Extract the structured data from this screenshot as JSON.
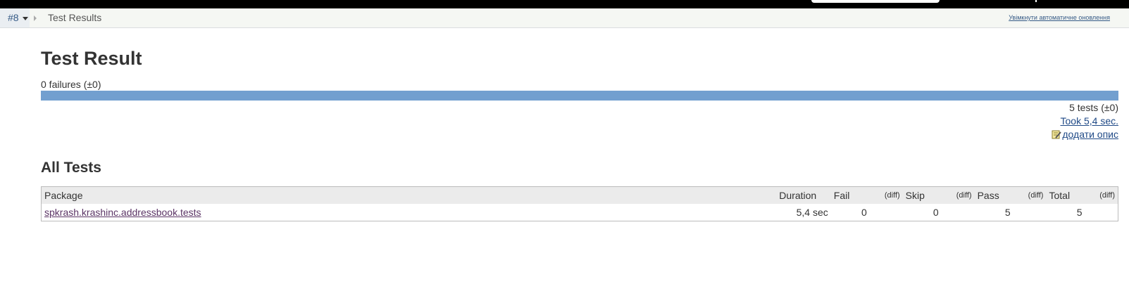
{
  "breadcrumb": {
    "build": "#8",
    "page": "Test Results",
    "auto_refresh": "Увімкнути автоматичне оновлення"
  },
  "title": "Test Result",
  "failures_text": "0 failures (±0)",
  "progress": {
    "pass_fraction": 1.0,
    "pass_color": "#729fcf",
    "fail_color": "#ef2929"
  },
  "summary": {
    "tests_text": "5 tests (±0)",
    "took_text": "Took 5,4 sec.",
    "add_description": "додати опис",
    "edit_icon": "notepad-pencil-icon"
  },
  "all_tests": {
    "title": "All Tests",
    "columns": {
      "package": "Package",
      "duration": "Duration",
      "fail": "Fail",
      "fail_diff": "(diff)",
      "skip": "Skip",
      "skip_diff": "(diff)",
      "pass": "Pass",
      "pass_diff": "(diff)",
      "total": "Total",
      "total_diff": "(diff)"
    },
    "rows": [
      {
        "package": "spkrash.krashinc.addressbook.tests",
        "duration": "5,4 sec",
        "fail": "0",
        "skip": "0",
        "pass": "5",
        "total": "5"
      }
    ]
  }
}
